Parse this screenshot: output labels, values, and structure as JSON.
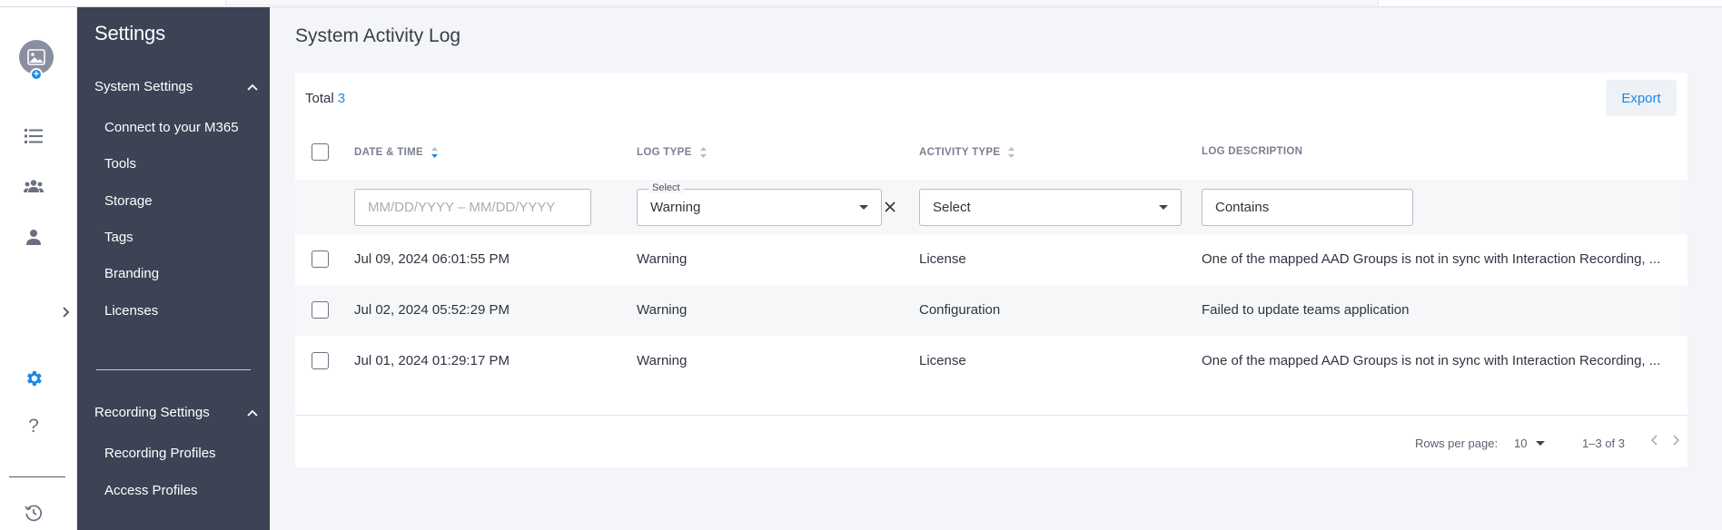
{
  "sidebar": {
    "title": "Settings",
    "system_settings": {
      "label": "System Settings",
      "items": [
        "Connect to your M365",
        "Tools",
        "Storage",
        "Tags",
        "Branding",
        "Licenses"
      ]
    },
    "recording_settings": {
      "label": "Recording Settings",
      "items": [
        "Recording Profiles",
        "Access Profiles"
      ]
    }
  },
  "rail": {
    "icons": [
      "avatar-image-icon",
      "add-icon",
      "list-icon",
      "group-icon",
      "person-icon",
      "chevron-right-icon",
      "gear-icon",
      "help-icon",
      "history-icon"
    ],
    "help_glyph": "?"
  },
  "main": {
    "title": "System Activity Log",
    "total_label": "Total",
    "total_count": "3",
    "export_label": "Export",
    "columns": [
      "DATE & TIME",
      "LOG TYPE",
      "ACTIVITY TYPE",
      "LOG DESCRIPTION"
    ],
    "filters": {
      "date_placeholder": "MM/DD/YYYY – MM/DD/YYYY",
      "log_type_legend": "Select",
      "log_type_value": "Warning",
      "activity_type_value": "Select",
      "description_value": "Contains"
    },
    "rows": [
      {
        "date": "Jul 09, 2024 06:01:55 PM",
        "log_type": "Warning",
        "activity_type": "License",
        "description": "One of the mapped AAD Groups is not in sync with Interaction Recording, ..."
      },
      {
        "date": "Jul 02, 2024 05:52:29 PM",
        "log_type": "Warning",
        "activity_type": "Configuration",
        "description": "Failed to update teams application"
      },
      {
        "date": "Jul 01, 2024 01:29:17 PM",
        "log_type": "Warning",
        "activity_type": "License",
        "description": "One of the mapped AAD Groups is not in sync with Interaction Recording, ..."
      }
    ],
    "pagination": {
      "rows_per_page_label": "Rows per page:",
      "rows_per_page_value": "10",
      "range": "1–3 of 3"
    }
  },
  "colors": {
    "accent": "#1e88e5",
    "sidebar_bg": "#3b4354",
    "page_bg": "#f4f5f8"
  }
}
